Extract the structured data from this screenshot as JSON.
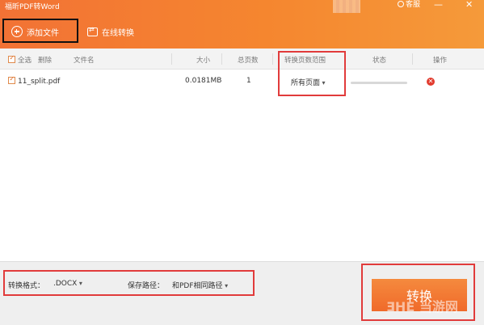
{
  "window": {
    "title": "福昕PDF转Word",
    "customer_label": "客服",
    "minimize": "—",
    "close": "✕"
  },
  "toolbar": {
    "add_file_label": "添加文件",
    "online_convert_label": "在线转换"
  },
  "table": {
    "headers": {
      "select_all": "全选",
      "delete": "删除",
      "filename": "文件名",
      "size": "大小",
      "total_pages": "总页数",
      "page_range": "转换页数范围",
      "status": "状态",
      "action": "操作"
    },
    "rows": [
      {
        "checked": true,
        "filename": "11_split.pdf",
        "size": "0.0181MB",
        "pages": "1",
        "page_range": "所有页面",
        "progress": 0
      }
    ]
  },
  "bottom": {
    "format_label": "转换格式：",
    "format_value": ".DOCX",
    "save_path_label": "保存路径：",
    "save_path_value": "和PDF相同路径",
    "convert_button": "转换",
    "watermark": "ƎHE 当游网"
  },
  "colors": {
    "header_orange": "#f27235",
    "highlight_red": "#e13b3b",
    "delete_red": "#e23b2e"
  }
}
